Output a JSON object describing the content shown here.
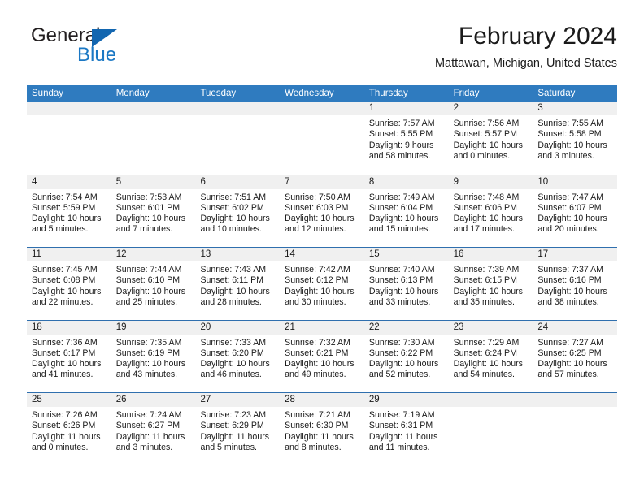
{
  "brand": {
    "name_top": "General",
    "name_bottom": "Blue",
    "triangle_color": "#1266b0",
    "blue_text_color": "#1b78c4"
  },
  "header": {
    "title": "February 2024",
    "subtitle": "Mattawan, Michigan, United States"
  },
  "theme": {
    "header_blue": "#2f7bbf",
    "row_divider_blue": "#2f6fae",
    "daynum_band": "#f0f0f0",
    "text": "#1a1a1a"
  },
  "weekdays": [
    "Sunday",
    "Monday",
    "Tuesday",
    "Wednesday",
    "Thursday",
    "Friday",
    "Saturday"
  ],
  "weeks": [
    [
      {
        "num": "",
        "sunrise": "",
        "sunset": "",
        "daylight_1": "",
        "daylight_2": ""
      },
      {
        "num": "",
        "sunrise": "",
        "sunset": "",
        "daylight_1": "",
        "daylight_2": ""
      },
      {
        "num": "",
        "sunrise": "",
        "sunset": "",
        "daylight_1": "",
        "daylight_2": ""
      },
      {
        "num": "",
        "sunrise": "",
        "sunset": "",
        "daylight_1": "",
        "daylight_2": ""
      },
      {
        "num": "1",
        "sunrise": "Sunrise: 7:57 AM",
        "sunset": "Sunset: 5:55 PM",
        "daylight_1": "Daylight: 9 hours",
        "daylight_2": "and 58 minutes."
      },
      {
        "num": "2",
        "sunrise": "Sunrise: 7:56 AM",
        "sunset": "Sunset: 5:57 PM",
        "daylight_1": "Daylight: 10 hours",
        "daylight_2": "and 0 minutes."
      },
      {
        "num": "3",
        "sunrise": "Sunrise: 7:55 AM",
        "sunset": "Sunset: 5:58 PM",
        "daylight_1": "Daylight: 10 hours",
        "daylight_2": "and 3 minutes."
      }
    ],
    [
      {
        "num": "4",
        "sunrise": "Sunrise: 7:54 AM",
        "sunset": "Sunset: 5:59 PM",
        "daylight_1": "Daylight: 10 hours",
        "daylight_2": "and 5 minutes."
      },
      {
        "num": "5",
        "sunrise": "Sunrise: 7:53 AM",
        "sunset": "Sunset: 6:01 PM",
        "daylight_1": "Daylight: 10 hours",
        "daylight_2": "and 7 minutes."
      },
      {
        "num": "6",
        "sunrise": "Sunrise: 7:51 AM",
        "sunset": "Sunset: 6:02 PM",
        "daylight_1": "Daylight: 10 hours",
        "daylight_2": "and 10 minutes."
      },
      {
        "num": "7",
        "sunrise": "Sunrise: 7:50 AM",
        "sunset": "Sunset: 6:03 PM",
        "daylight_1": "Daylight: 10 hours",
        "daylight_2": "and 12 minutes."
      },
      {
        "num": "8",
        "sunrise": "Sunrise: 7:49 AM",
        "sunset": "Sunset: 6:04 PM",
        "daylight_1": "Daylight: 10 hours",
        "daylight_2": "and 15 minutes."
      },
      {
        "num": "9",
        "sunrise": "Sunrise: 7:48 AM",
        "sunset": "Sunset: 6:06 PM",
        "daylight_1": "Daylight: 10 hours",
        "daylight_2": "and 17 minutes."
      },
      {
        "num": "10",
        "sunrise": "Sunrise: 7:47 AM",
        "sunset": "Sunset: 6:07 PM",
        "daylight_1": "Daylight: 10 hours",
        "daylight_2": "and 20 minutes."
      }
    ],
    [
      {
        "num": "11",
        "sunrise": "Sunrise: 7:45 AM",
        "sunset": "Sunset: 6:08 PM",
        "daylight_1": "Daylight: 10 hours",
        "daylight_2": "and 22 minutes."
      },
      {
        "num": "12",
        "sunrise": "Sunrise: 7:44 AM",
        "sunset": "Sunset: 6:10 PM",
        "daylight_1": "Daylight: 10 hours",
        "daylight_2": "and 25 minutes."
      },
      {
        "num": "13",
        "sunrise": "Sunrise: 7:43 AM",
        "sunset": "Sunset: 6:11 PM",
        "daylight_1": "Daylight: 10 hours",
        "daylight_2": "and 28 minutes."
      },
      {
        "num": "14",
        "sunrise": "Sunrise: 7:42 AM",
        "sunset": "Sunset: 6:12 PM",
        "daylight_1": "Daylight: 10 hours",
        "daylight_2": "and 30 minutes."
      },
      {
        "num": "15",
        "sunrise": "Sunrise: 7:40 AM",
        "sunset": "Sunset: 6:13 PM",
        "daylight_1": "Daylight: 10 hours",
        "daylight_2": "and 33 minutes."
      },
      {
        "num": "16",
        "sunrise": "Sunrise: 7:39 AM",
        "sunset": "Sunset: 6:15 PM",
        "daylight_1": "Daylight: 10 hours",
        "daylight_2": "and 35 minutes."
      },
      {
        "num": "17",
        "sunrise": "Sunrise: 7:37 AM",
        "sunset": "Sunset: 6:16 PM",
        "daylight_1": "Daylight: 10 hours",
        "daylight_2": "and 38 minutes."
      }
    ],
    [
      {
        "num": "18",
        "sunrise": "Sunrise: 7:36 AM",
        "sunset": "Sunset: 6:17 PM",
        "daylight_1": "Daylight: 10 hours",
        "daylight_2": "and 41 minutes."
      },
      {
        "num": "19",
        "sunrise": "Sunrise: 7:35 AM",
        "sunset": "Sunset: 6:19 PM",
        "daylight_1": "Daylight: 10 hours",
        "daylight_2": "and 43 minutes."
      },
      {
        "num": "20",
        "sunrise": "Sunrise: 7:33 AM",
        "sunset": "Sunset: 6:20 PM",
        "daylight_1": "Daylight: 10 hours",
        "daylight_2": "and 46 minutes."
      },
      {
        "num": "21",
        "sunrise": "Sunrise: 7:32 AM",
        "sunset": "Sunset: 6:21 PM",
        "daylight_1": "Daylight: 10 hours",
        "daylight_2": "and 49 minutes."
      },
      {
        "num": "22",
        "sunrise": "Sunrise: 7:30 AM",
        "sunset": "Sunset: 6:22 PM",
        "daylight_1": "Daylight: 10 hours",
        "daylight_2": "and 52 minutes."
      },
      {
        "num": "23",
        "sunrise": "Sunrise: 7:29 AM",
        "sunset": "Sunset: 6:24 PM",
        "daylight_1": "Daylight: 10 hours",
        "daylight_2": "and 54 minutes."
      },
      {
        "num": "24",
        "sunrise": "Sunrise: 7:27 AM",
        "sunset": "Sunset: 6:25 PM",
        "daylight_1": "Daylight: 10 hours",
        "daylight_2": "and 57 minutes."
      }
    ],
    [
      {
        "num": "25",
        "sunrise": "Sunrise: 7:26 AM",
        "sunset": "Sunset: 6:26 PM",
        "daylight_1": "Daylight: 11 hours",
        "daylight_2": "and 0 minutes."
      },
      {
        "num": "26",
        "sunrise": "Sunrise: 7:24 AM",
        "sunset": "Sunset: 6:27 PM",
        "daylight_1": "Daylight: 11 hours",
        "daylight_2": "and 3 minutes."
      },
      {
        "num": "27",
        "sunrise": "Sunrise: 7:23 AM",
        "sunset": "Sunset: 6:29 PM",
        "daylight_1": "Daylight: 11 hours",
        "daylight_2": "and 5 minutes."
      },
      {
        "num": "28",
        "sunrise": "Sunrise: 7:21 AM",
        "sunset": "Sunset: 6:30 PM",
        "daylight_1": "Daylight: 11 hours",
        "daylight_2": "and 8 minutes."
      },
      {
        "num": "29",
        "sunrise": "Sunrise: 7:19 AM",
        "sunset": "Sunset: 6:31 PM",
        "daylight_1": "Daylight: 11 hours",
        "daylight_2": "and 11 minutes."
      },
      {
        "num": "",
        "sunrise": "",
        "sunset": "",
        "daylight_1": "",
        "daylight_2": ""
      },
      {
        "num": "",
        "sunrise": "",
        "sunset": "",
        "daylight_1": "",
        "daylight_2": ""
      }
    ]
  ]
}
